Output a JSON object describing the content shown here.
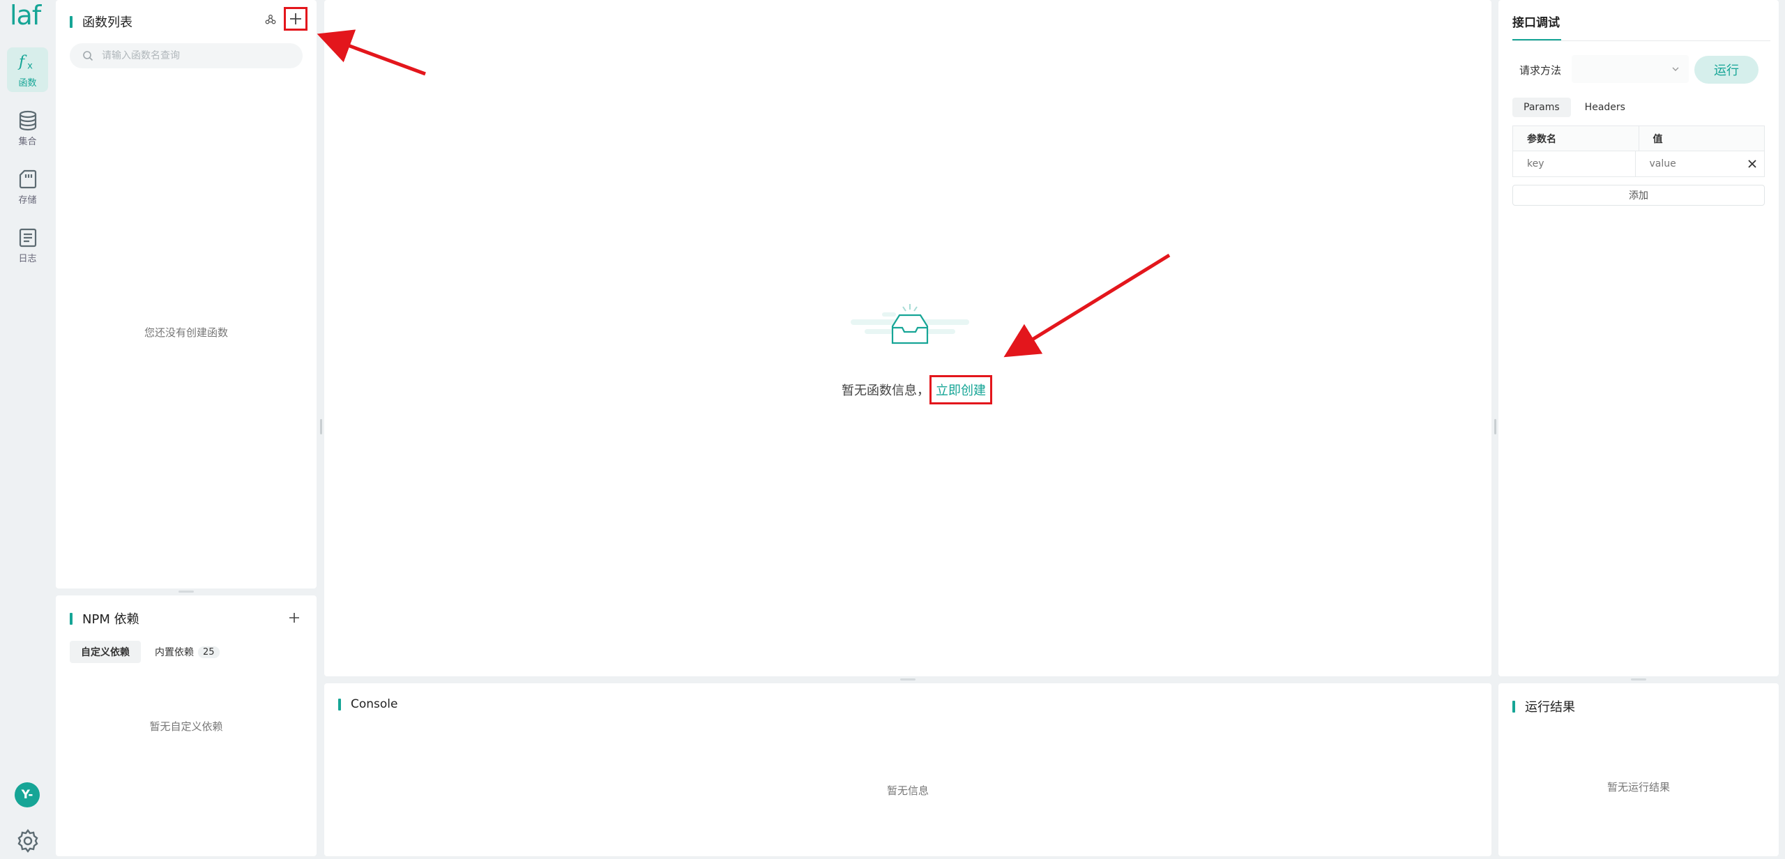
{
  "app": {
    "logo_text": "laf"
  },
  "nav": [
    {
      "label": "函数",
      "icon": "function-icon",
      "active": true
    },
    {
      "label": "集合",
      "icon": "database-icon",
      "active": false
    },
    {
      "label": "存储",
      "icon": "storage-icon",
      "active": false
    },
    {
      "label": "日志",
      "icon": "log-icon",
      "active": false
    }
  ],
  "user": {
    "avatar_text": "Y-"
  },
  "functions": {
    "title": "函数列表",
    "search_placeholder": "请输入函数名查询",
    "empty": "您还没有创建函数"
  },
  "npm": {
    "title": "NPM 依赖",
    "tabs": [
      "自定义依赖",
      "内置依赖"
    ],
    "builtin_count": "25",
    "empty": "暂无自定义依赖"
  },
  "editor": {
    "empty_message": "暂无函数信息，",
    "create_link": "立即创建"
  },
  "console": {
    "title": "Console",
    "empty": "暂无信息"
  },
  "api": {
    "title": "接口调试",
    "method_label": "请求方法",
    "method_value": "",
    "run_label": "运行",
    "tabs": [
      "Params",
      "Headers"
    ],
    "columns": [
      "参数名",
      "值"
    ],
    "key_placeholder": "key",
    "value_placeholder": "value",
    "add_label": "添加"
  },
  "result": {
    "title": "运行结果",
    "empty": "暂无运行结果"
  },
  "colors": {
    "accent": "#16a596",
    "annotation": "#e3161c"
  }
}
